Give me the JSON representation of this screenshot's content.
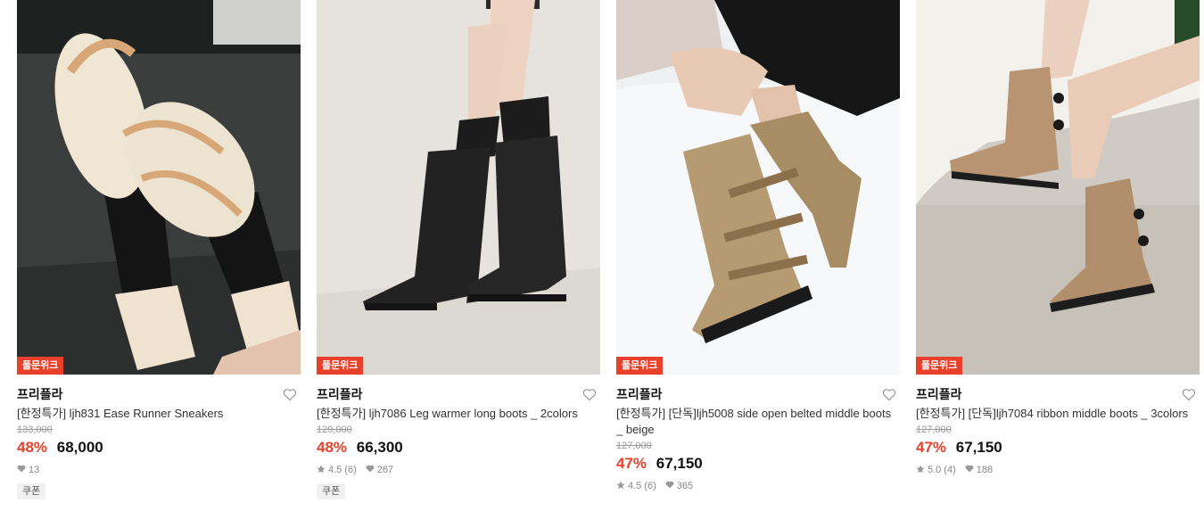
{
  "products": [
    {
      "badge": "풀문위크",
      "brand": "프리플라",
      "title": "[한정특가] ljh831 Ease Runner Sneakers",
      "original_price": "133,000",
      "discount": "48%",
      "price": "68,000",
      "rating": "",
      "reviews": "",
      "likes": "13",
      "coupon": "쿠폰"
    },
    {
      "badge": "풀문위크",
      "brand": "프리플라",
      "title": "[한정특가] ljh7086 Leg warmer long boots _ 2colors",
      "original_price": "129,000",
      "discount": "48%",
      "price": "66,300",
      "rating": "4.5",
      "reviews": "(6)",
      "likes": "267",
      "coupon": "쿠폰"
    },
    {
      "badge": "풀문위크",
      "brand": "프리플라",
      "title": "[한정특가] [단독]ljh5008 side open belted middle boots _ beige",
      "original_price": "127,000",
      "discount": "47%",
      "price": "67,150",
      "rating": "4.5",
      "reviews": "(6)",
      "likes": "365",
      "coupon": ""
    },
    {
      "badge": "풀문위크",
      "brand": "프리플라",
      "title": "[한정특가] [단독]ljh7084 ribbon middle boots _ 3colors",
      "original_price": "127,000",
      "discount": "47%",
      "price": "67,150",
      "rating": "5.0",
      "reviews": "(4)",
      "likes": "188",
      "coupon": ""
    }
  ],
  "colors": {
    "accent": "#e8402a",
    "text": "#111111",
    "muted": "#888888"
  },
  "icons": {
    "wishlist": "heart-outline-icon",
    "rating": "star-icon",
    "likes": "heart-filled-icon"
  }
}
